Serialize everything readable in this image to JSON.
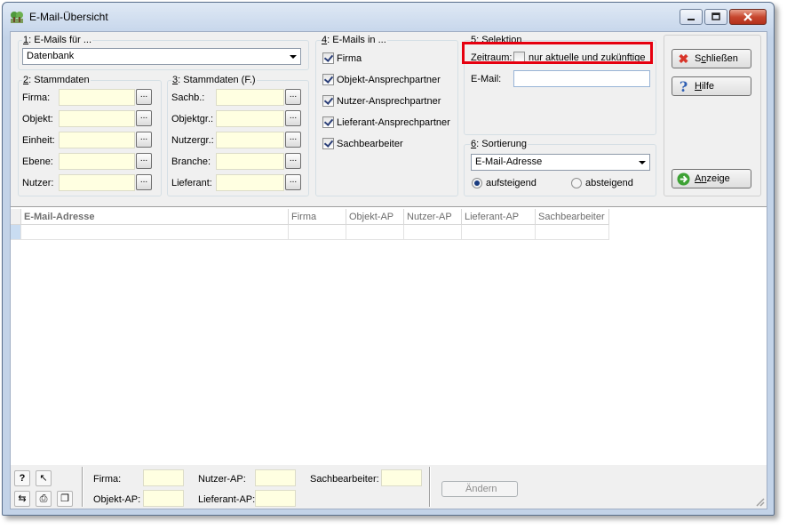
{
  "window": {
    "title": "E-Mail-Übersicht",
    "icon": "tree-app-icon"
  },
  "group1": {
    "num": "1",
    "rest": ": E-Mails für ...",
    "select_value": "Datenbank"
  },
  "group2": {
    "num": "2",
    "rest": ": Stammdaten",
    "fields": [
      {
        "label": "Firma:"
      },
      {
        "label": "Objekt:"
      },
      {
        "label": "Einheit:"
      },
      {
        "label": "Ebene:"
      },
      {
        "label": "Nutzer:"
      }
    ]
  },
  "group3": {
    "num": "3",
    "rest": ": Stammdaten (F.)",
    "fields": [
      {
        "label": "Sachb.:"
      },
      {
        "label": "Objektgr.:"
      },
      {
        "label": "Nutzergr.:"
      },
      {
        "label": "Branche:"
      },
      {
        "label": "Lieferant:"
      }
    ]
  },
  "dots_label": "...",
  "group4": {
    "num": "4",
    "rest": ": E-Mails in ...",
    "checks": [
      {
        "label": "Firma",
        "checked": true
      },
      {
        "label": "Objekt-Ansprechpartner",
        "checked": true
      },
      {
        "label": "Nutzer-Ansprechpartner",
        "checked": true
      },
      {
        "label": "Lieferant-Ansprechpartner",
        "checked": true
      },
      {
        "label": "Sachbearbeiter",
        "checked": true
      }
    ]
  },
  "group5": {
    "title": "5: Selektion",
    "zeitraum_label": "Zeitraum:",
    "zeitraum_check_label": "nur aktuelle und zukünftige",
    "zeitraum_checked": false,
    "email_label": "E-Mail:"
  },
  "group6": {
    "num": "6",
    "rest": ": Sortierung",
    "select_value": "E-Mail-Adresse",
    "radio_asc": "aufsteigend",
    "radio_desc": "absteigend",
    "selected": "aufsteigend"
  },
  "buttons": {
    "close_first": "S",
    "close_under": "c",
    "close_rest": "hließen",
    "help_under": "H",
    "help_rest": "ilfe",
    "show_first": "A",
    "show_under": "n",
    "show_rest": "zeige",
    "change": "Ändern"
  },
  "grid": {
    "columns": [
      "E-Mail-Adresse",
      "Firma",
      "Objekt-AP",
      "Nutzer-AP",
      "Lieferant-AP",
      "Sachbearbeiter"
    ]
  },
  "footer": {
    "firma": "Firma:",
    "objekt_ap": "Objekt-AP:",
    "nutzer_ap": "Nutzer-AP:",
    "lieferant_ap": "Lieferant-AP:",
    "sachbearbeiter": "Sachbearbeiter:"
  },
  "colors": {
    "highlight": "#e6000f",
    "field_bg": "#ffffe1",
    "accent": "#2b3f78"
  }
}
